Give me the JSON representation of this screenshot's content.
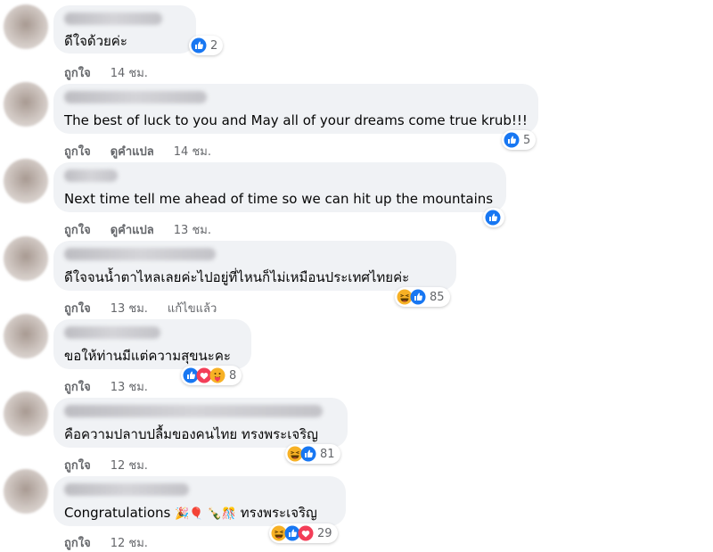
{
  "comments": [
    {
      "text": "ดีใจด้วยค่ะ",
      "reaction_count": "2",
      "reactions": [
        "like"
      ],
      "actions": {
        "like": "ถูกใจ",
        "time": "14 ชม."
      }
    },
    {
      "text": "The best of luck to you and May all of your dreams come true krub!!!",
      "reaction_count": "5",
      "reactions": [
        "like"
      ],
      "actions": {
        "like": "ถูกใจ",
        "translate": "ดูคำแปล",
        "time": "14 ชม."
      }
    },
    {
      "text": "Next time tell me ahead of time so we can hit up the mountains",
      "reaction_count": "",
      "reactions": [
        "like"
      ],
      "actions": {
        "like": "ถูกใจ",
        "translate": "ดูคำแปล",
        "time": "13 ชม."
      }
    },
    {
      "text": "ดีใจจนน้ำตาไหลเลยค่ะไปอยู่ที่ไหนก็ไม่เหมือนประเทศไทยค่ะ",
      "reaction_count": "85",
      "reactions": [
        "haha",
        "like"
      ],
      "actions": {
        "like": "ถูกใจ",
        "time": "13 ชม.",
        "edited": "แก้ไขแล้ว"
      }
    },
    {
      "text": "ขอให้ท่านมีแต่ความสุขนะคะ",
      "reaction_count": "8",
      "reactions": [
        "like",
        "love",
        "care"
      ],
      "actions": {
        "like": "ถูกใจ",
        "time": "13 ชม."
      }
    },
    {
      "text": "คือความปลาบปลื้มของคนไทย ทรงพระเจริญ",
      "reaction_count": "81",
      "reactions": [
        "haha",
        "like"
      ],
      "actions": {
        "like": "ถูกใจ",
        "time": "12 ชม."
      }
    },
    {
      "text_prefix": "Congratulations",
      "emojis": "🎉🎈 🍾🎊",
      "text_suffix": "ทรงพระเจริญ",
      "reaction_count": "29",
      "reactions": [
        "haha",
        "like",
        "love"
      ],
      "actions": {
        "like": "ถูกใจ",
        "time": "12 ชม."
      }
    }
  ],
  "colors": {
    "like": "#1877f2",
    "love": "#f33e58",
    "haha": "#f7b125",
    "bubble": "#f0f2f5",
    "meta": "#65676b"
  }
}
